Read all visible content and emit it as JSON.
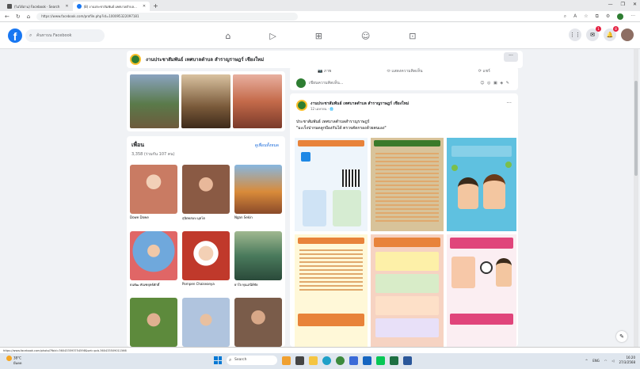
{
  "browser": {
    "tabs": [
      {
        "label": "(ไม่ได้อ่าน) Facebook · Search",
        "active": false
      },
      {
        "label": "(8) งานประชาสัมพันธ์ เทศบาลตำบล...",
        "active": true
      }
    ],
    "new_tab": "+",
    "url": "https://www.facebook.com/profile.php?id=100095322097181",
    "win_controls": [
      "—",
      "❐",
      "✕"
    ]
  },
  "fb_header": {
    "logo": "f",
    "search_placeholder": "ค้นหาบน Facebook",
    "nav_icons": [
      "home-icon",
      "video-icon",
      "marketplace-icon",
      "groups-icon",
      "gaming-icon"
    ],
    "nav_glyphs": [
      "⌂",
      "▷",
      "⊞",
      "☺",
      "⊡"
    ],
    "right_icons": [
      {
        "name": "menu-icon",
        "glyph": "⋮⋮",
        "badge": ""
      },
      {
        "name": "messenger-icon",
        "glyph": "✉",
        "badge": "1"
      },
      {
        "name": "notifications-icon",
        "glyph": "🔔",
        "badge": "8"
      },
      {
        "name": "profile-avatar",
        "glyph": "",
        "badge": ""
      }
    ]
  },
  "page_bar": {
    "title": "งานประชาสัมพันธ์ เทศบาลตำบล สำราญราษฎร์ เชียงใหม่",
    "more": "···"
  },
  "friends": {
    "title": "เพื่อน",
    "count": "3,358 (ร่วมกัน 107 คน)",
    "see_all": "ดูเพื่อนทั้งหมด",
    "items": [
      {
        "name": "Dowe Dowe",
        "color": "#c97b63"
      },
      {
        "name": "สุนิตยสมบ มุตโต",
        "color": "#8a5a44"
      },
      {
        "name": "Ngan Sekin",
        "color": "#d98b3a"
      },
      {
        "name": "ธนพัฒ ทัณฑยุทธ์ศักดิ์",
        "color": "#6fa8dc"
      },
      {
        "name": "Pornpen Chaiseanya",
        "color": "#c0392b"
      },
      {
        "name": "ยาใจ ทุนเสนีย์ชัย",
        "color": "#4a7a5c"
      },
      {
        "name": "",
        "color": "#5d8a3c"
      },
      {
        "name": "",
        "color": "#b0c4de"
      },
      {
        "name": "",
        "color": "#7a5c4a"
      }
    ]
  },
  "composer": {
    "tabs": [
      "📷 ภาพ",
      "⬭ แสดงความคิดเห็น",
      "⟳ แชร์"
    ],
    "placeholder": "เขียนความคิดเห็น...",
    "icons": "☺ ◎ ▣ ◈ ✎"
  },
  "post": {
    "author": "งานประชาสัมพันธ์ เทศบาลตำบล สำราญราษฎร์ เชียงใหม่",
    "time": "12 เมษายน · 🌐",
    "line1": "ประชาสัมพันธ์ เทศบาลตำบลสำราญราษฎร์",
    "line2": "\"มะเร็งปากมดลูกป้องกันได้ ตรวจคัดกรองด้วยตนเอง\"",
    "more": "···"
  },
  "status_url": "https://www.facebook.com/photo/?fbid=360433593754598&set=pcb.360433509011566",
  "taskbar": {
    "weather_temp": "38°C",
    "weather_desc": "มีแดด",
    "search": "Search",
    "lang": "ENG",
    "time": "16:20",
    "date": "27/3/2568"
  },
  "colors": {
    "fb_blue": "#1877f2",
    "page_bg": "#f0f2f5"
  }
}
